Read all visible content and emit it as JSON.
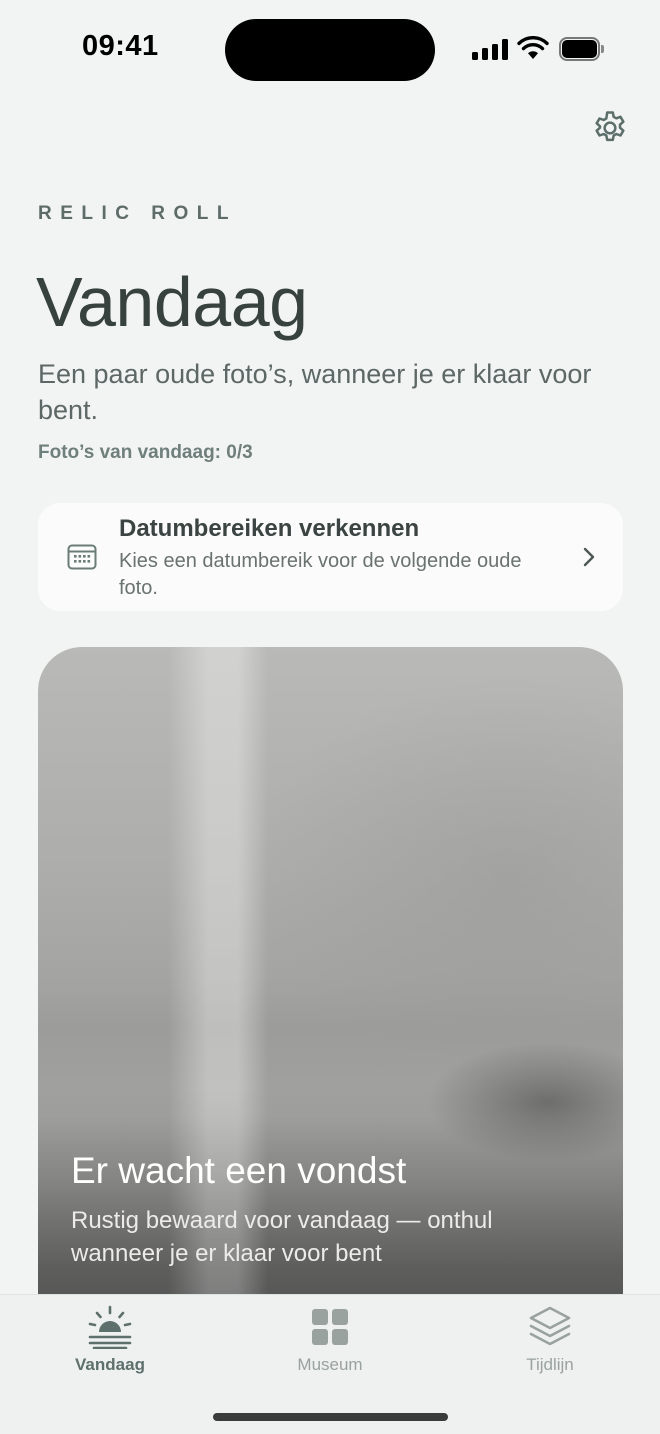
{
  "status_bar": {
    "time": "09:41"
  },
  "app": {
    "brand": "RELIC ROLL"
  },
  "header": {
    "title": "Vandaag",
    "subtitle": "Een paar oude foto’s, wanneer je er klaar voor bent.",
    "count": "Foto’s van vandaag: 0/3"
  },
  "explore_card": {
    "title": "Datumbereiken verkennen",
    "description": "Kies een datumbereik voor de volgende oude foto.",
    "icon": "calendar-icon"
  },
  "photo_card": {
    "title": "Er wacht een vondst",
    "description": "Rustig bewaard voor vandaag — onthul wanneer je er klaar voor bent"
  },
  "tabs": [
    {
      "label": "Vandaag",
      "icon": "sunrise-icon",
      "active": true
    },
    {
      "label": "Museum",
      "icon": "grid-icon",
      "active": false
    },
    {
      "label": "Tijdlijn",
      "icon": "layers-icon",
      "active": false
    }
  ],
  "colors": {
    "background": "#f2f4f3",
    "accent": "#5e706b",
    "text": "#37423f",
    "muted": "#6f7f7b"
  }
}
